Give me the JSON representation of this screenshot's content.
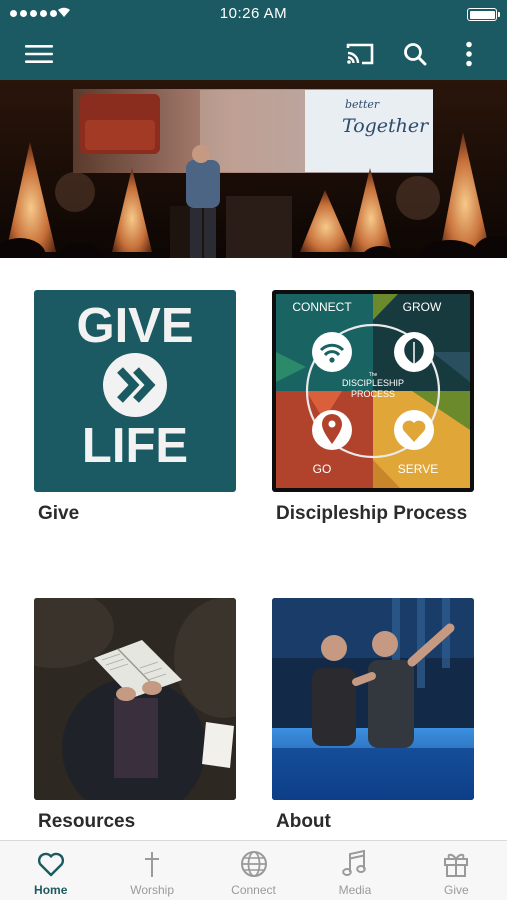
{
  "status_bar": {
    "time": "10:26 AM"
  },
  "app_bar": {
    "menu_icon": "hamburger-menu-icon",
    "cast_icon": "cast-icon",
    "search_icon": "search-icon",
    "more_icon": "more-vertical-icon",
    "background_color": "#1b5a62"
  },
  "hero": {
    "screen_text": [
      "better",
      "Together"
    ]
  },
  "tiles": [
    {
      "label": "Give",
      "image_text": [
        "GIVE",
        "LIFE"
      ]
    },
    {
      "label": "Discipleship Process",
      "image_text": {
        "connect": "CONNECT",
        "grow": "GROW",
        "center_small": "The",
        "center_main": "DISCIPLESHIP",
        "center_sub": "PROCESS",
        "go": "GO",
        "serve": "SERVE"
      }
    },
    {
      "label": "Resources"
    },
    {
      "label": "About"
    }
  ],
  "tab_bar": {
    "active_color": "#1b5a62",
    "inactive_color": "#9a9a9a",
    "items": [
      {
        "label": "Home",
        "icon": "heart-icon",
        "active": true
      },
      {
        "label": "Worship",
        "icon": "cross-icon",
        "active": false
      },
      {
        "label": "Connect",
        "icon": "globe-icon",
        "active": false
      },
      {
        "label": "Media",
        "icon": "music-note-icon",
        "active": false
      },
      {
        "label": "Give",
        "icon": "gift-icon",
        "active": false
      }
    ]
  }
}
